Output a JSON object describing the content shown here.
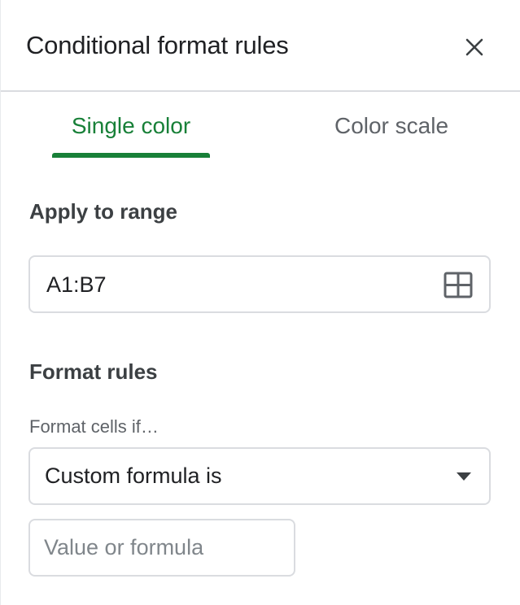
{
  "header": {
    "title": "Conditional format rules",
    "close_icon": "close-icon"
  },
  "tabs": [
    {
      "label": "Single color",
      "active": true
    },
    {
      "label": "Color scale",
      "active": false
    }
  ],
  "apply_to_range": {
    "label": "Apply to range",
    "value": "A1:B7",
    "icon": "grid-select-icon"
  },
  "format_rules": {
    "label": "Format rules",
    "condition_label": "Format cells if…",
    "condition_selected": "Custom formula is",
    "dropdown_icon": "dropdown-arrow-icon",
    "value_placeholder": "Value or formula",
    "value": ""
  },
  "colors": {
    "accent": "#188038",
    "inactive_tab": "#5f6368",
    "border": "#dadce0",
    "text": "#202124"
  }
}
